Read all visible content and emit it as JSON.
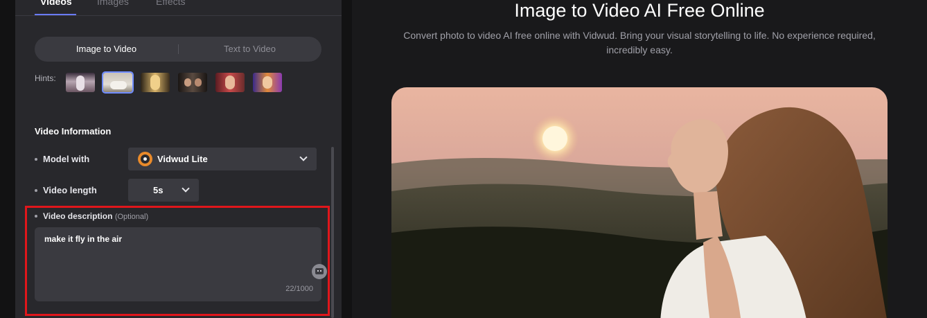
{
  "top_tabs": {
    "videos": "Videos",
    "images": "Images",
    "effects": "Effects"
  },
  "mode_toggle": {
    "image_to_video": "Image to Video",
    "text_to_video": "Text to Video"
  },
  "hints": {
    "label": "Hints:",
    "selected_index": 1
  },
  "video_information": {
    "title": "Video Information",
    "model_label": "Model with",
    "model_value": "Vidwud Lite",
    "length_label": "Video length",
    "length_value": "5s",
    "description_label": "Video description",
    "description_optional": "(Optional)",
    "description_value": "make it fly in the air",
    "char_count": "22/1000"
  },
  "main": {
    "title": "Image to Video AI Free Online",
    "subtitle": "Convert photo to video AI free online with Vidwud. Bring your visual storytelling to life. No experience required, incredibly easy."
  },
  "colors": {
    "accent": "#6f8cff",
    "highlight_border": "#e0161b",
    "model_logo": "#e98a2a"
  }
}
